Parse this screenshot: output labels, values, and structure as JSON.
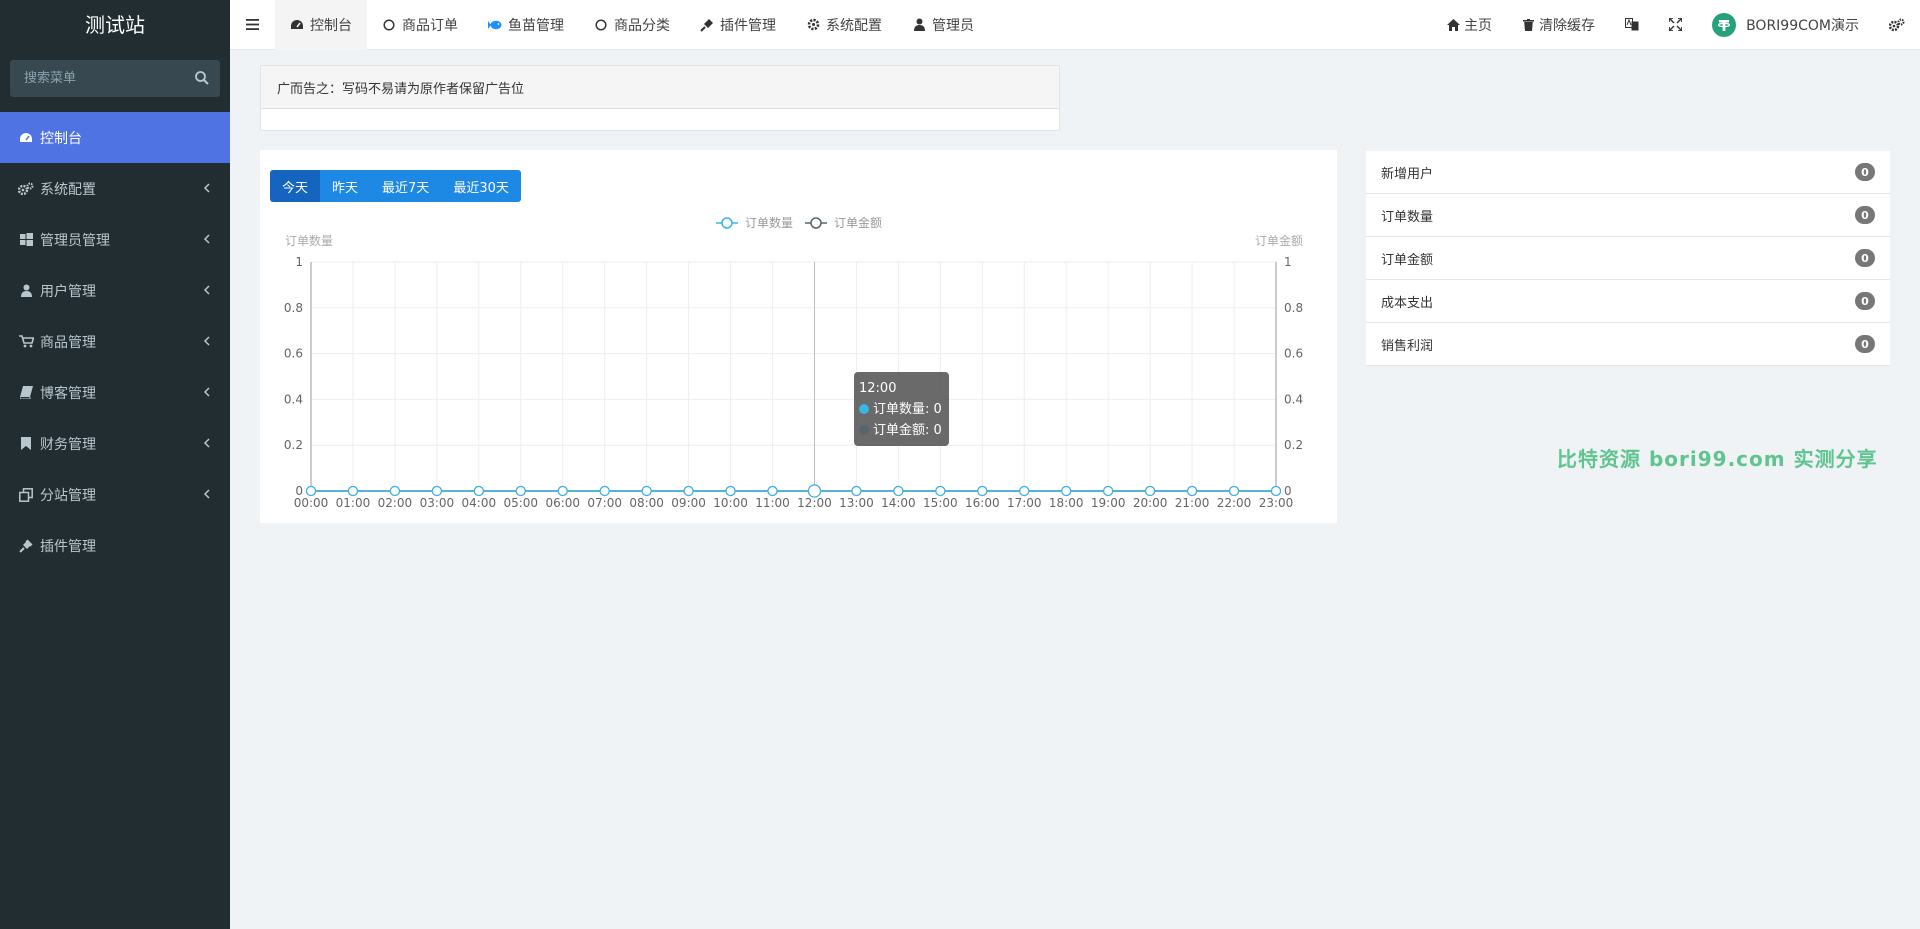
{
  "sidebar": {
    "brand": "测试站",
    "search_placeholder": "搜索菜单",
    "items": [
      {
        "label": "控制台",
        "icon": "dashboard-icon",
        "active": true
      },
      {
        "label": "系统配置",
        "icon": "cogs-icon"
      },
      {
        "label": "管理员管理",
        "icon": "windows-icon"
      },
      {
        "label": "用户管理",
        "icon": "user-icon"
      },
      {
        "label": "商品管理",
        "icon": "cart-icon"
      },
      {
        "label": "博客管理",
        "icon": "book-icon"
      },
      {
        "label": "财务管理",
        "icon": "bookmark-icon"
      },
      {
        "label": "分站管理",
        "icon": "clone-icon"
      },
      {
        "label": "插件管理",
        "icon": "plug-icon"
      }
    ]
  },
  "navbar": {
    "tabs": [
      {
        "label": "控制台",
        "icon": "dashboard-icon"
      },
      {
        "label": "商品订单",
        "icon": "circle-icon"
      },
      {
        "label": "鱼苗管理",
        "icon": "fish-icon"
      },
      {
        "label": "商品分类",
        "icon": "circle-icon"
      },
      {
        "label": "插件管理",
        "icon": "plug-icon"
      },
      {
        "label": "系统配置",
        "icon": "gear-icon"
      },
      {
        "label": "管理员",
        "icon": "user-icon"
      }
    ],
    "right": {
      "home": "主页",
      "clear_cache": "清除缓存",
      "user": "BORI99COM演示"
    }
  },
  "ad": {
    "text": "广而告之：写码不易请为原作者保留广告位"
  },
  "chart_panel": {
    "ranges": [
      "今天",
      "昨天",
      "最近7天",
      "最近30天"
    ],
    "tooltip": {
      "time": "12:00",
      "line1": "订单数量: 0",
      "line2": "订单金额: 0"
    }
  },
  "chart_data": {
    "type": "line",
    "x": [
      "00:00",
      "01:00",
      "02:00",
      "03:00",
      "04:00",
      "05:00",
      "06:00",
      "07:00",
      "08:00",
      "09:00",
      "10:00",
      "11:00",
      "12:00",
      "13:00",
      "14:00",
      "15:00",
      "16:00",
      "17:00",
      "18:00",
      "19:00",
      "20:00",
      "21:00",
      "22:00",
      "23:00"
    ],
    "series": [
      {
        "name": "订单数量",
        "values": [
          0,
          0,
          0,
          0,
          0,
          0,
          0,
          0,
          0,
          0,
          0,
          0,
          0,
          0,
          0,
          0,
          0,
          0,
          0,
          0,
          0,
          0,
          0,
          0
        ],
        "color": "#3ab5e6"
      },
      {
        "name": "订单金额",
        "values": [
          0,
          0,
          0,
          0,
          0,
          0,
          0,
          0,
          0,
          0,
          0,
          0,
          0,
          0,
          0,
          0,
          0,
          0,
          0,
          0,
          0,
          0,
          0,
          0
        ],
        "color": "#546570"
      }
    ],
    "ylabel_left": "订单数量",
    "ylabel_right": "订单金额",
    "ylim": [
      0,
      1
    ],
    "yticks": [
      "0",
      "0.2",
      "0.4",
      "0.6",
      "0.8",
      "1"
    ],
    "legend_position": "top-center",
    "grid": true
  },
  "stats": [
    {
      "label": "新增用户",
      "value": "0"
    },
    {
      "label": "订单数量",
      "value": "0"
    },
    {
      "label": "订单金额",
      "value": "0"
    },
    {
      "label": "成本支出",
      "value": "0"
    },
    {
      "label": "销售利润",
      "value": "0"
    }
  ],
  "watermark": "比特资源 bori99.com 实测分享"
}
